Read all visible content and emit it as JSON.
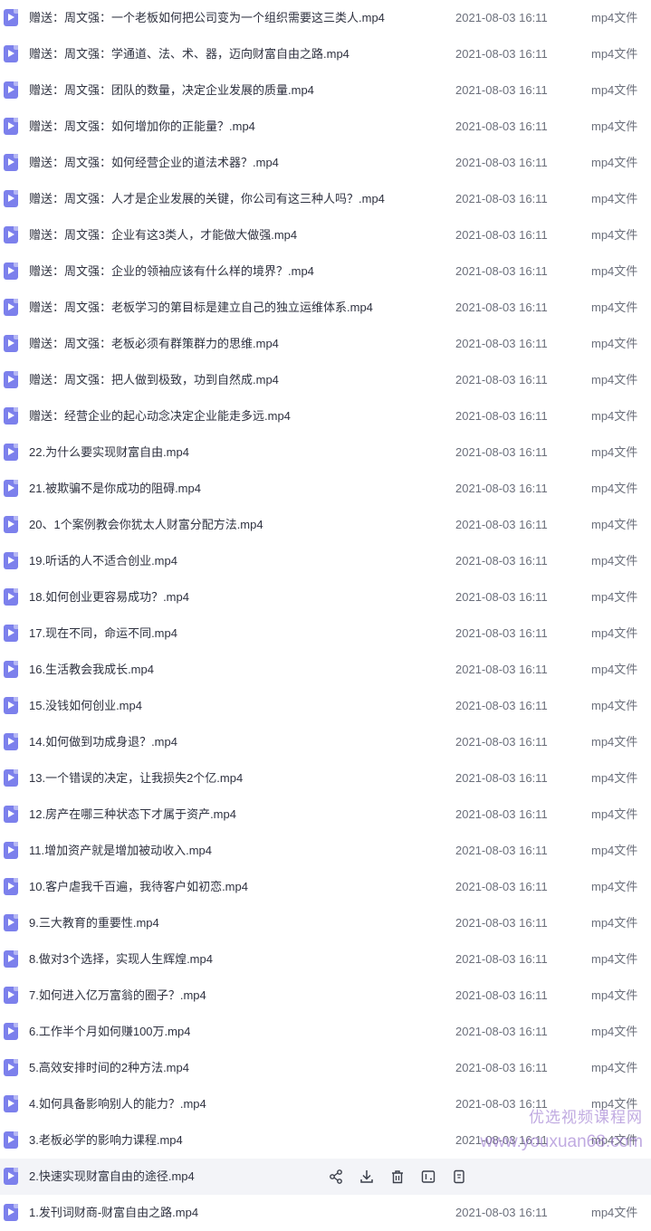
{
  "files": [
    {
      "name": "赠送：周文强：一个老板如何把公司变为一个组织需要这三类人.mp4",
      "date": "2021-08-03 16:11",
      "type": "mp4文件"
    },
    {
      "name": "赠送：周文强：学通道、法、术、器，迈向财富自由之路.mp4",
      "date": "2021-08-03 16:11",
      "type": "mp4文件"
    },
    {
      "name": "赠送：周文强：团队的数量，决定企业发展的质量.mp4",
      "date": "2021-08-03 16:11",
      "type": "mp4文件"
    },
    {
      "name": "赠送：周文强：如何增加你的正能量？.mp4",
      "date": "2021-08-03 16:11",
      "type": "mp4文件"
    },
    {
      "name": "赠送：周文强：如何经营企业的道法术器？.mp4",
      "date": "2021-08-03 16:11",
      "type": "mp4文件"
    },
    {
      "name": "赠送：周文强：人才是企业发展的关键，你公司有这三种人吗？.mp4",
      "date": "2021-08-03 16:11",
      "type": "mp4文件"
    },
    {
      "name": "赠送：周文强：企业有这3类人，才能做大做强.mp4",
      "date": "2021-08-03 16:11",
      "type": "mp4文件"
    },
    {
      "name": "赠送：周文强：企业的领袖应该有什么样的境界？.mp4",
      "date": "2021-08-03 16:11",
      "type": "mp4文件"
    },
    {
      "name": "赠送：周文强：老板学习的第目标是建立自己的独立运维体系.mp4",
      "date": "2021-08-03 16:11",
      "type": "mp4文件"
    },
    {
      "name": "赠送：周文强：老板必须有群策群力的思维.mp4",
      "date": "2021-08-03 16:11",
      "type": "mp4文件"
    },
    {
      "name": "赠送：周文强：把人做到极致，功到自然成.mp4",
      "date": "2021-08-03 16:11",
      "type": "mp4文件"
    },
    {
      "name": "赠送：经营企业的起心动念决定企业能走多远.mp4",
      "date": "2021-08-03 16:11",
      "type": "mp4文件"
    },
    {
      "name": "22.为什么要实现财富自由.mp4",
      "date": "2021-08-03 16:11",
      "type": "mp4文件"
    },
    {
      "name": "21.被欺骗不是你成功的阻碍.mp4",
      "date": "2021-08-03 16:11",
      "type": "mp4文件"
    },
    {
      "name": "20、1个案例教会你犹太人财富分配方法.mp4",
      "date": "2021-08-03 16:11",
      "type": "mp4文件"
    },
    {
      "name": "19.听话的人不适合创业.mp4",
      "date": "2021-08-03 16:11",
      "type": "mp4文件"
    },
    {
      "name": "18.如何创业更容易成功？.mp4",
      "date": "2021-08-03 16:11",
      "type": "mp4文件"
    },
    {
      "name": "17.现在不同，命运不同.mp4",
      "date": "2021-08-03 16:11",
      "type": "mp4文件"
    },
    {
      "name": "16.生活教会我成长.mp4",
      "date": "2021-08-03 16:11",
      "type": "mp4文件"
    },
    {
      "name": "15.没钱如何创业.mp4",
      "date": "2021-08-03 16:11",
      "type": "mp4文件"
    },
    {
      "name": "14.如何做到功成身退？.mp4",
      "date": "2021-08-03 16:11",
      "type": "mp4文件"
    },
    {
      "name": "13.一个错误的决定，让我损失2个亿.mp4",
      "date": "2021-08-03 16:11",
      "type": "mp4文件"
    },
    {
      "name": "12.房产在哪三种状态下才属于资产.mp4",
      "date": "2021-08-03 16:11",
      "type": "mp4文件"
    },
    {
      "name": "11.增加资产就是增加被动收入.mp4",
      "date": "2021-08-03 16:11",
      "type": "mp4文件"
    },
    {
      "name": "10.客户虐我千百遍，我待客户如初恋.mp4",
      "date": "2021-08-03 16:11",
      "type": "mp4文件"
    },
    {
      "name": "9.三大教育的重要性.mp4",
      "date": "2021-08-03 16:11",
      "type": "mp4文件"
    },
    {
      "name": "8.做对3个选择，实现人生辉煌.mp4",
      "date": "2021-08-03 16:11",
      "type": "mp4文件"
    },
    {
      "name": "7.如何进入亿万富翁的圈子？.mp4",
      "date": "2021-08-03 16:11",
      "type": "mp4文件"
    },
    {
      "name": "6.工作半个月如何赚100万.mp4",
      "date": "2021-08-03 16:11",
      "type": "mp4文件"
    },
    {
      "name": "5.高效安排时间的2种方法.mp4",
      "date": "2021-08-03 16:11",
      "type": "mp4文件"
    },
    {
      "name": "4.如何具备影响别人的能力？.mp4",
      "date": "2021-08-03 16:11",
      "type": "mp4文件"
    },
    {
      "name": "3.老板必学的影响力课程.mp4",
      "date": "2021-08-03 16:11",
      "type": "mp4文件"
    },
    {
      "name": "2.快速实现财富自由的途径.mp4",
      "date": "",
      "type": "",
      "hovered": true
    },
    {
      "name": "1.发刊词财商-财富自由之路.mp4",
      "date": "2021-08-03 16:11",
      "type": "mp4文件"
    }
  ],
  "hover_actions": [
    "share-icon",
    "download-icon",
    "delete-icon",
    "rename-icon",
    "more-icon"
  ],
  "watermark": {
    "line1": "优选视频课程网",
    "line2": "www.youxuan68.com"
  },
  "colors": {
    "file_icon": "#7c80ec",
    "hover_row": "#f3f4f8",
    "watermark": "#8c64c8"
  }
}
